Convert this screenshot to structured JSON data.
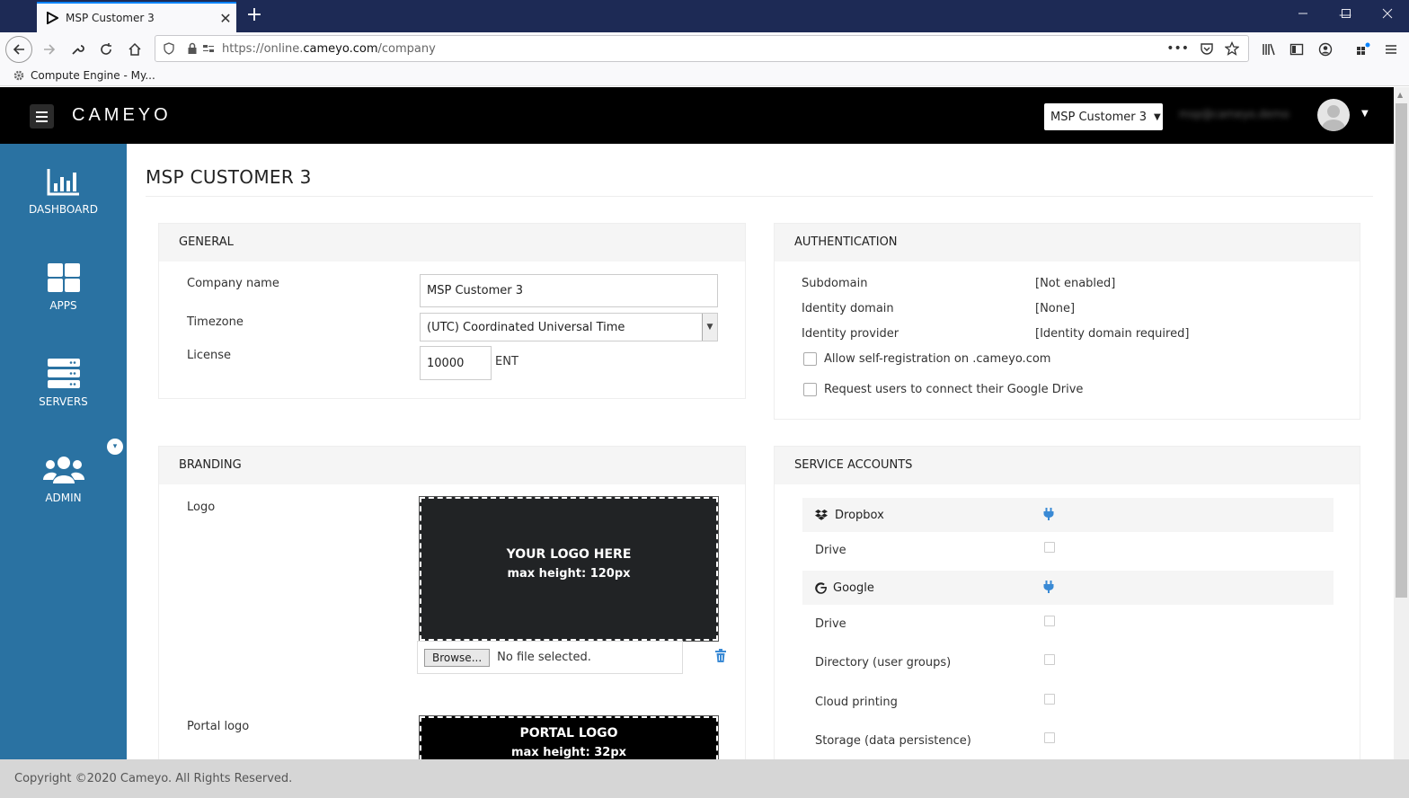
{
  "browser": {
    "tab_title": "MSP Customer 3",
    "tab_close": "✕",
    "new_tab": "+",
    "url_prefix": "https://online.",
    "url_host": "cameyo.com",
    "url_path": "/company",
    "bookmark_label": "Compute Engine - My..."
  },
  "header": {
    "logo_text": "CAMEYO",
    "customer_selector": "MSP Customer 3",
    "user_email": "msp@cameyo.demo"
  },
  "sidebar": {
    "items": [
      {
        "label": "DASHBOARD"
      },
      {
        "label": "APPS"
      },
      {
        "label": "SERVERS"
      },
      {
        "label": "ADMIN"
      }
    ]
  },
  "page": {
    "title": "MSP CUSTOMER 3"
  },
  "general": {
    "heading": "GENERAL",
    "company_label": "Company name",
    "company_value": "MSP Customer 3",
    "timezone_label": "Timezone",
    "timezone_value": "(UTC) Coordinated Universal Time",
    "license_label": "License",
    "license_value": "10000",
    "license_unit": "ENT"
  },
  "auth": {
    "heading": "AUTHENTICATION",
    "rows": [
      {
        "label": "Subdomain",
        "value": "[Not enabled]"
      },
      {
        "label": "Identity domain",
        "value": "[None]"
      },
      {
        "label": "Identity provider",
        "value": "[Identity domain required]"
      }
    ],
    "self_registration": "Allow self-registration on .cameyo.com",
    "google_drive": "Request users to connect their Google Drive"
  },
  "branding": {
    "heading": "BRANDING",
    "logo_label": "Logo",
    "logo_line1": "YOUR LOGO HERE",
    "logo_line2": "max height: 120px",
    "browse_label": "Browse...",
    "no_file": "No file selected.",
    "portal_label": "Portal logo",
    "portal_line1": "PORTAL LOGO",
    "portal_line2": "max height: 32px"
  },
  "service_accounts": {
    "heading": "SERVICE ACCOUNTS",
    "dropbox": "Dropbox",
    "dropbox_drive": "Drive",
    "google": "Google",
    "google_items": [
      "Drive",
      "Directory (user groups)",
      "Cloud printing",
      "Storage (data persistence)"
    ]
  },
  "footer": {
    "text": "Copyright ©2020 Cameyo. All Rights Reserved."
  },
  "colors": {
    "sidebar": "#2a72a2",
    "header": "#000000",
    "accent": "#3a8ad5"
  }
}
